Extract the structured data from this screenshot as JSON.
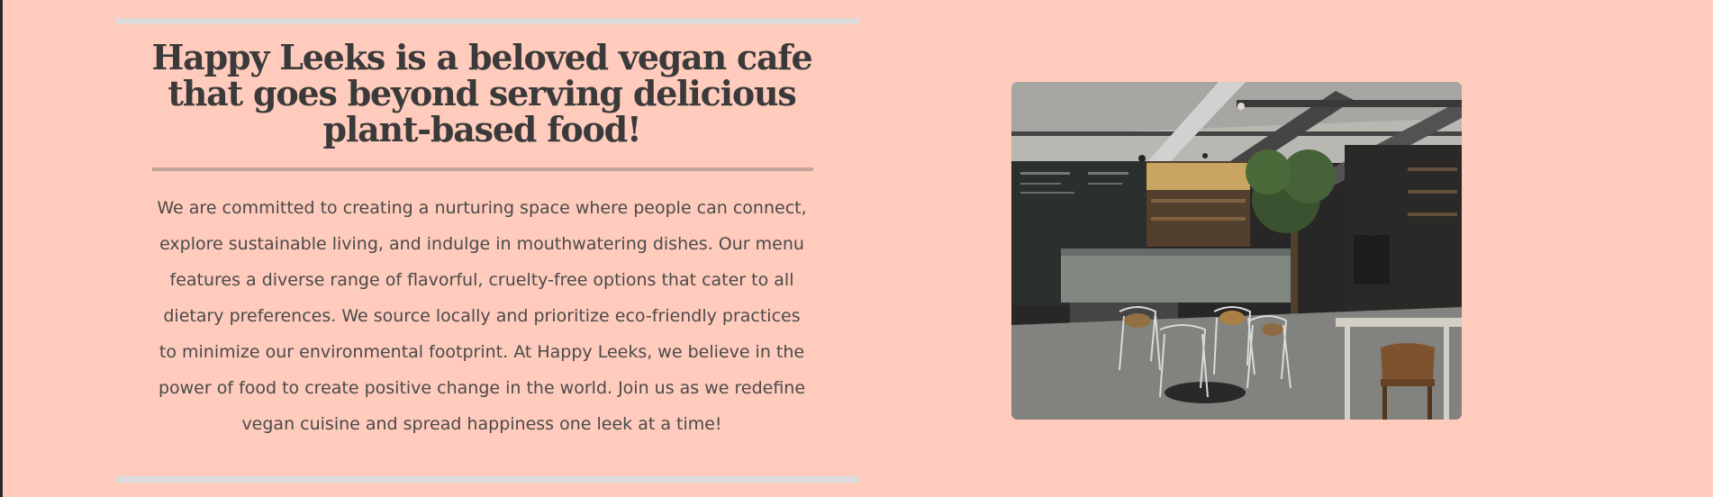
{
  "about": {
    "heading": "Happy Leeks is a beloved vegan cafe that goes beyond serving delicious plant-based food!",
    "body": "We are committed to creating a nurturing space where people can connect, explore sustainable living, and indulge in mouthwatering dishes. Our menu features a diverse range of flavorful, cruelty-free options that cater to all dietary preferences. We source locally and prioritize eco-friendly practices to minimize our environmental footprint. At Happy Leeks, we believe in the power of food to create positive change in the world. Join us as we redefine vegan cuisine and spread happiness one leek at a time!"
  },
  "colors": {
    "background": "#ffcbbc",
    "heading_text": "#3a3a3a",
    "body_text": "#4a4a4a",
    "divider": "#dcdcdc",
    "heading_underline": "#c4a49a"
  },
  "image": {
    "subject": "cafe-interior-photo"
  }
}
